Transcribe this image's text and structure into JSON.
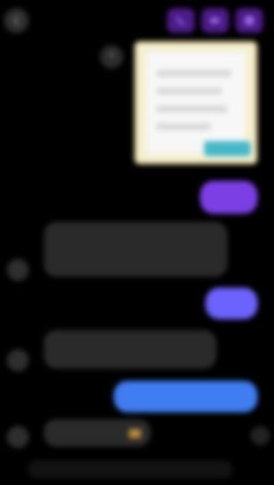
{
  "header": {
    "title": "",
    "actions": [
      {
        "name": "call-icon"
      },
      {
        "name": "video-icon"
      },
      {
        "name": "info-icon"
      }
    ]
  },
  "messages": {
    "shared_image": {
      "icon": "share-icon"
    },
    "sent": [
      {
        "text": ""
      },
      {
        "text": ""
      },
      {
        "text": ""
      }
    ],
    "received": [
      {
        "line1": "",
        "line2": ""
      },
      {
        "line1": ""
      },
      {
        "line1": ""
      }
    ]
  },
  "composer": {
    "placeholder": ""
  },
  "colors": {
    "background": "#000000",
    "sent_purple": "#7b3fe4",
    "sent_indigo": "#6c63ff",
    "sent_blue": "#3f7df0",
    "received_gray": "#2a2a2a",
    "header_action": "#4b1c86"
  }
}
